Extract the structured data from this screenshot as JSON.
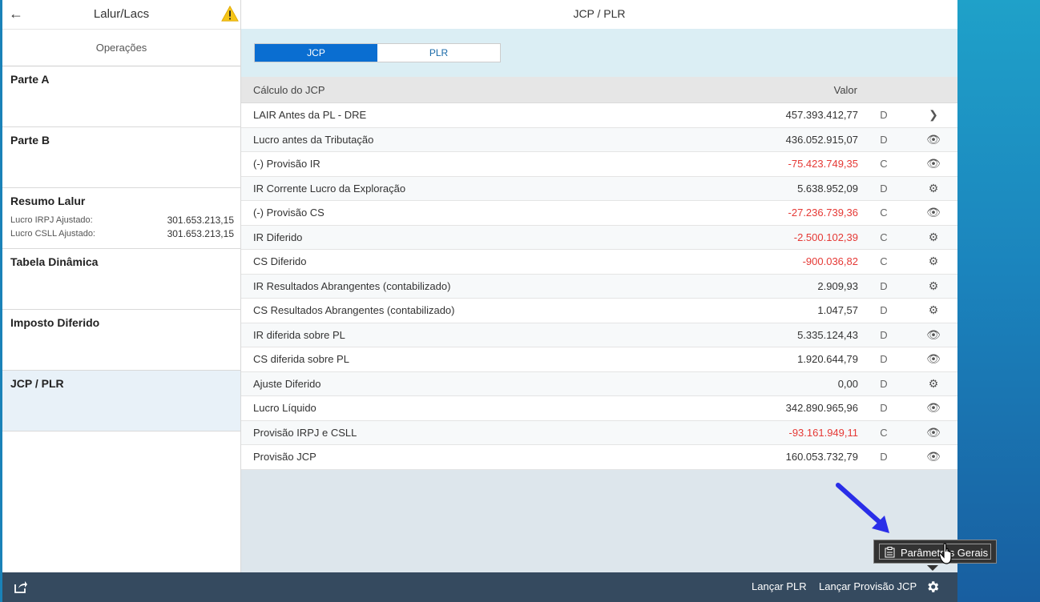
{
  "left": {
    "title": "Lalur/Lacs",
    "subheader": "Operações",
    "sections": [
      {
        "title": "Parte A"
      },
      {
        "title": "Parte B"
      },
      {
        "title": "Resumo Lalur",
        "items": [
          {
            "label": "Lucro IRPJ Ajustado:",
            "value": "301.653.213,15"
          },
          {
            "label": "Lucro CSLL Ajustado:",
            "value": "301.653.213,15"
          }
        ]
      },
      {
        "title": "Tabela Dinâmica"
      },
      {
        "title": "Imposto Diferido"
      },
      {
        "title": "JCP / PLR"
      }
    ]
  },
  "right": {
    "title": "JCP / PLR",
    "tabs": [
      "JCP",
      "PLR"
    ],
    "table": {
      "headers": [
        "Cálculo do JCP",
        "Valor"
      ],
      "rows": [
        {
          "label": "LAIR Antes da PL - DRE",
          "value": "457.393.412,77",
          "dc": "D",
          "icon": "chevron-right-icon",
          "glyph": "❯"
        },
        {
          "label": "Lucro antes da Tributação",
          "value": "436.052.915,07",
          "dc": "D",
          "icon": "eye-icon",
          "glyph": "👁"
        },
        {
          "label": "(-) Provisão IR",
          "value": "-75.423.749,35",
          "dc": "C",
          "icon": "eye-icon",
          "glyph": "👁"
        },
        {
          "label": "IR Corrente Lucro da Exploração",
          "value": "5.638.952,09",
          "dc": "D",
          "icon": "gear-icon",
          "glyph": "⚙"
        },
        {
          "label": "(-) Provisão CS",
          "value": "-27.236.739,36",
          "dc": "C",
          "icon": "eye-icon",
          "glyph": "👁"
        },
        {
          "label": "IR Diferido",
          "value": "-2.500.102,39",
          "dc": "C",
          "icon": "gear-icon",
          "glyph": "⚙"
        },
        {
          "label": "CS Diferido",
          "value": "-900.036,82",
          "dc": "C",
          "icon": "gear-icon",
          "glyph": "⚙"
        },
        {
          "label": "IR Resultados Abrangentes (contabilizado)",
          "value": "2.909,93",
          "dc": "D",
          "icon": "gear-icon",
          "glyph": "⚙"
        },
        {
          "label": "CS Resultados Abrangentes (contabilizado)",
          "value": "1.047,57",
          "dc": "D",
          "icon": "gear-icon",
          "glyph": "⚙"
        },
        {
          "label": "IR diferida sobre PL",
          "value": "5.335.124,43",
          "dc": "D",
          "icon": "eye-icon",
          "glyph": "👁"
        },
        {
          "label": "CS diferida sobre PL",
          "value": "1.920.644,79",
          "dc": "D",
          "icon": "eye-icon",
          "glyph": "👁"
        },
        {
          "label": "Ajuste Diferido",
          "value": "0,00",
          "dc": "D",
          "icon": "gear-icon",
          "glyph": "⚙"
        },
        {
          "label": "Lucro Líquido",
          "value": "342.890.965,96",
          "dc": "D",
          "icon": "eye-icon",
          "glyph": "👁"
        },
        {
          "label": "Provisão IRPJ e CSLL",
          "value": "-93.161.949,11",
          "dc": "C",
          "icon": "eye-icon",
          "glyph": "👁"
        },
        {
          "label": "Provisão JCP",
          "value": "160.053.732,79",
          "dc": "D",
          "icon": "eye-icon",
          "glyph": "👁"
        }
      ]
    }
  },
  "footer": {
    "btn_plr": "Lançar PLR",
    "btn_jcp": "Lançar Provisão JCP"
  },
  "tooltip": {
    "text": "Parâmetros Gerais"
  },
  "colors": {
    "accent": "#0a6ed1",
    "negative": "#e53935",
    "footer": "#354a5f"
  }
}
